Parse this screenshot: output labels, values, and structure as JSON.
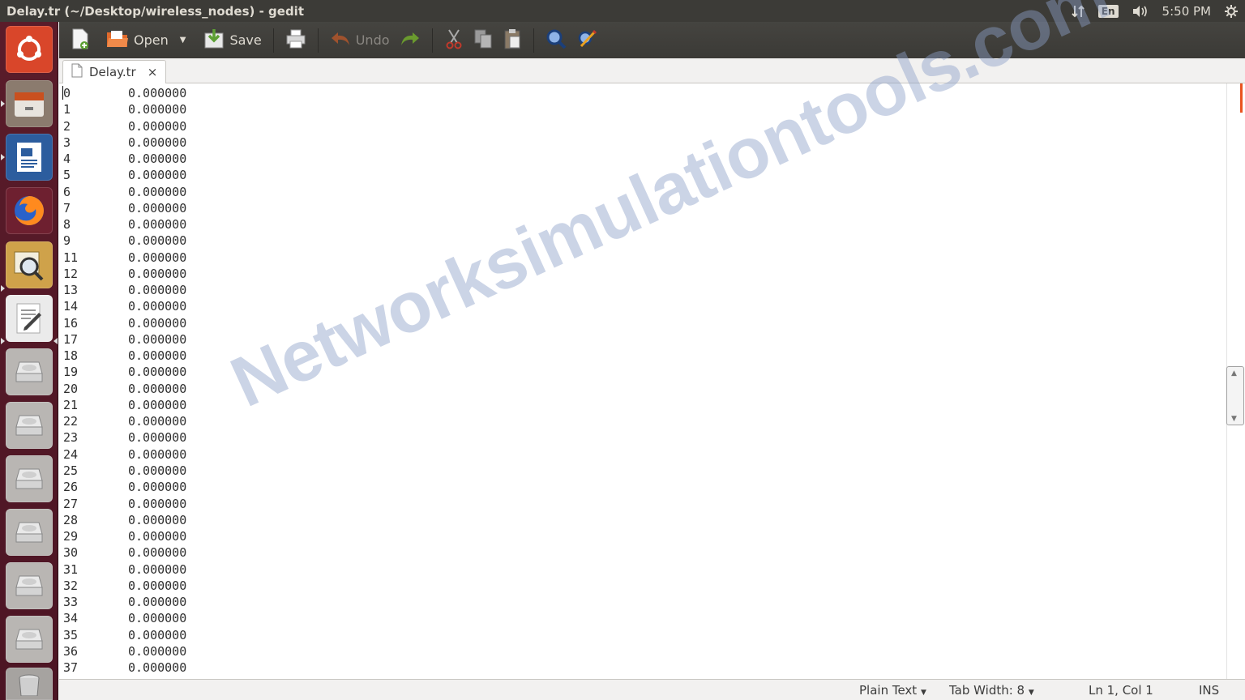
{
  "window": {
    "title": "Delay.tr (~/Desktop/wireless_nodes) - gedit"
  },
  "panel": {
    "keyboard": "En",
    "clock": "5:50 PM"
  },
  "toolbar": {
    "open_label": "Open",
    "save_label": "Save",
    "undo_label": "Undo"
  },
  "tabs": [
    {
      "label": "Delay.tr",
      "close": "×"
    }
  ],
  "document": {
    "lines": [
      {
        "id": "0",
        "value": "0.000000"
      },
      {
        "id": "1",
        "value": "0.000000"
      },
      {
        "id": "2",
        "value": "0.000000"
      },
      {
        "id": "3",
        "value": "0.000000"
      },
      {
        "id": "4",
        "value": "0.000000"
      },
      {
        "id": "5",
        "value": "0.000000"
      },
      {
        "id": "6",
        "value": "0.000000"
      },
      {
        "id": "7",
        "value": "0.000000"
      },
      {
        "id": "8",
        "value": "0.000000"
      },
      {
        "id": "9",
        "value": "0.000000"
      },
      {
        "id": "11",
        "value": "0.000000"
      },
      {
        "id": "12",
        "value": "0.000000"
      },
      {
        "id": "13",
        "value": "0.000000"
      },
      {
        "id": "14",
        "value": "0.000000"
      },
      {
        "id": "16",
        "value": "0.000000"
      },
      {
        "id": "17",
        "value": "0.000000"
      },
      {
        "id": "18",
        "value": "0.000000"
      },
      {
        "id": "19",
        "value": "0.000000"
      },
      {
        "id": "20",
        "value": "0.000000"
      },
      {
        "id": "21",
        "value": "0.000000"
      },
      {
        "id": "22",
        "value": "0.000000"
      },
      {
        "id": "23",
        "value": "0.000000"
      },
      {
        "id": "24",
        "value": "0.000000"
      },
      {
        "id": "25",
        "value": "0.000000"
      },
      {
        "id": "26",
        "value": "0.000000"
      },
      {
        "id": "27",
        "value": "0.000000"
      },
      {
        "id": "28",
        "value": "0.000000"
      },
      {
        "id": "29",
        "value": "0.000000"
      },
      {
        "id": "30",
        "value": "0.000000"
      },
      {
        "id": "31",
        "value": "0.000000"
      },
      {
        "id": "32",
        "value": "0.000000"
      },
      {
        "id": "33",
        "value": "0.000000"
      },
      {
        "id": "34",
        "value": "0.000000"
      },
      {
        "id": "35",
        "value": "0.000000"
      },
      {
        "id": "36",
        "value": "0.000000"
      },
      {
        "id": "37",
        "value": "0.000000"
      }
    ]
  },
  "watermark": {
    "text": "Networksimulationtools.com"
  },
  "statusbar": {
    "language": "Plain Text",
    "tab_width": "Tab Width: 8",
    "position": "Ln 1, Col 1",
    "mode": "INS"
  },
  "launcher": {
    "items": [
      "ubuntu-dash-icon",
      "files-icon",
      "writer-icon",
      "firefox-icon",
      "image-viewer-icon",
      "text-editor-icon",
      "drive-icon",
      "drive-icon",
      "drive-icon",
      "drive-icon",
      "drive-icon",
      "drive-icon",
      "trash-icon"
    ]
  },
  "colors": {
    "panel": "#3c3b37",
    "launcher": "#5a1c2a",
    "accent": "#e95420"
  }
}
